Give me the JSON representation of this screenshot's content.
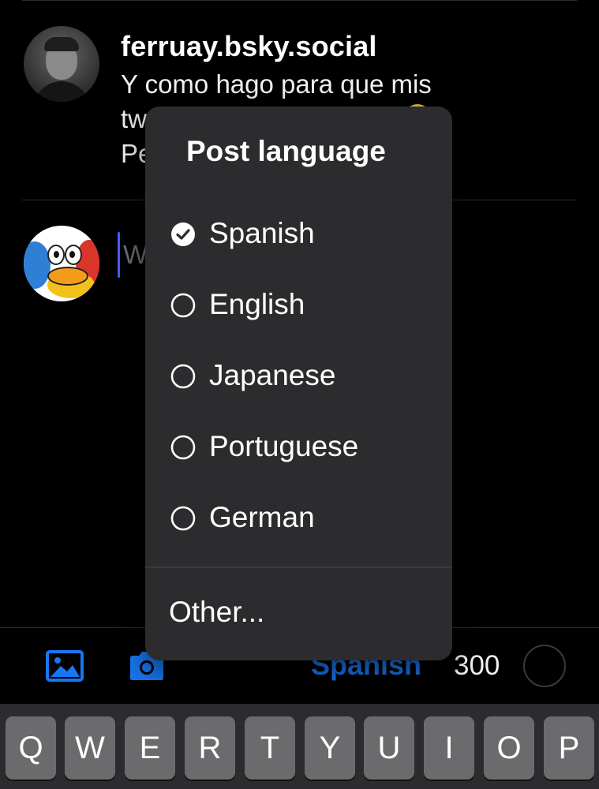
{
  "reply_post": {
    "handle": "ferruay.bsky.social",
    "line1": "Y como hago para que mis",
    "line2": "tw",
    "line3": "Pe"
  },
  "compose": {
    "placeholder_fragment": "W"
  },
  "popup": {
    "title": "Post language",
    "items": [
      {
        "label": "Spanish",
        "selected": true
      },
      {
        "label": "English",
        "selected": false
      },
      {
        "label": "Japanese",
        "selected": false
      },
      {
        "label": "Portuguese",
        "selected": false
      },
      {
        "label": "German",
        "selected": false
      }
    ],
    "other_label": "Other..."
  },
  "toolbar": {
    "language_label": "Spanish",
    "char_count": "300",
    "accent_color": "#1877f2"
  },
  "keyboard": {
    "keys": [
      "Q",
      "W",
      "E",
      "R",
      "T",
      "Y",
      "U",
      "I",
      "O",
      "P"
    ]
  },
  "icons": {
    "image": "image-icon",
    "camera": "camera-icon",
    "check": "check-circle-icon",
    "radio": "radio-empty-icon"
  }
}
